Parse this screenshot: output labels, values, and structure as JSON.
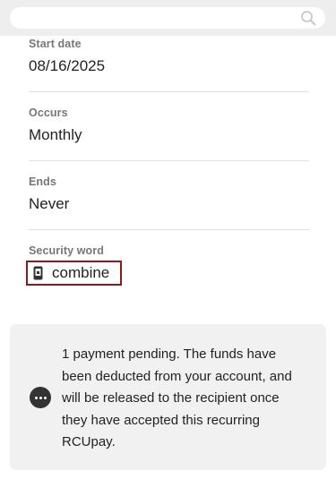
{
  "search": {
    "placeholder": ""
  },
  "fields": [
    {
      "label": "Start date",
      "value": "08/16/2025"
    },
    {
      "label": "Occurs",
      "value": "Monthly"
    },
    {
      "label": "Ends",
      "value": "Never"
    },
    {
      "label": "Security word",
      "value": "combine"
    }
  ],
  "notice": {
    "text": "1 payment pending. The funds have been deducted from your account, and will be released to the recipient once they have accepted this recurring RCUpay.",
    "icon": "more-dots-icon"
  },
  "colors": {
    "highlight_border": "#8b1a1a",
    "notice_background": "#f1f1f1",
    "topbar_background": "#eeeeee"
  }
}
